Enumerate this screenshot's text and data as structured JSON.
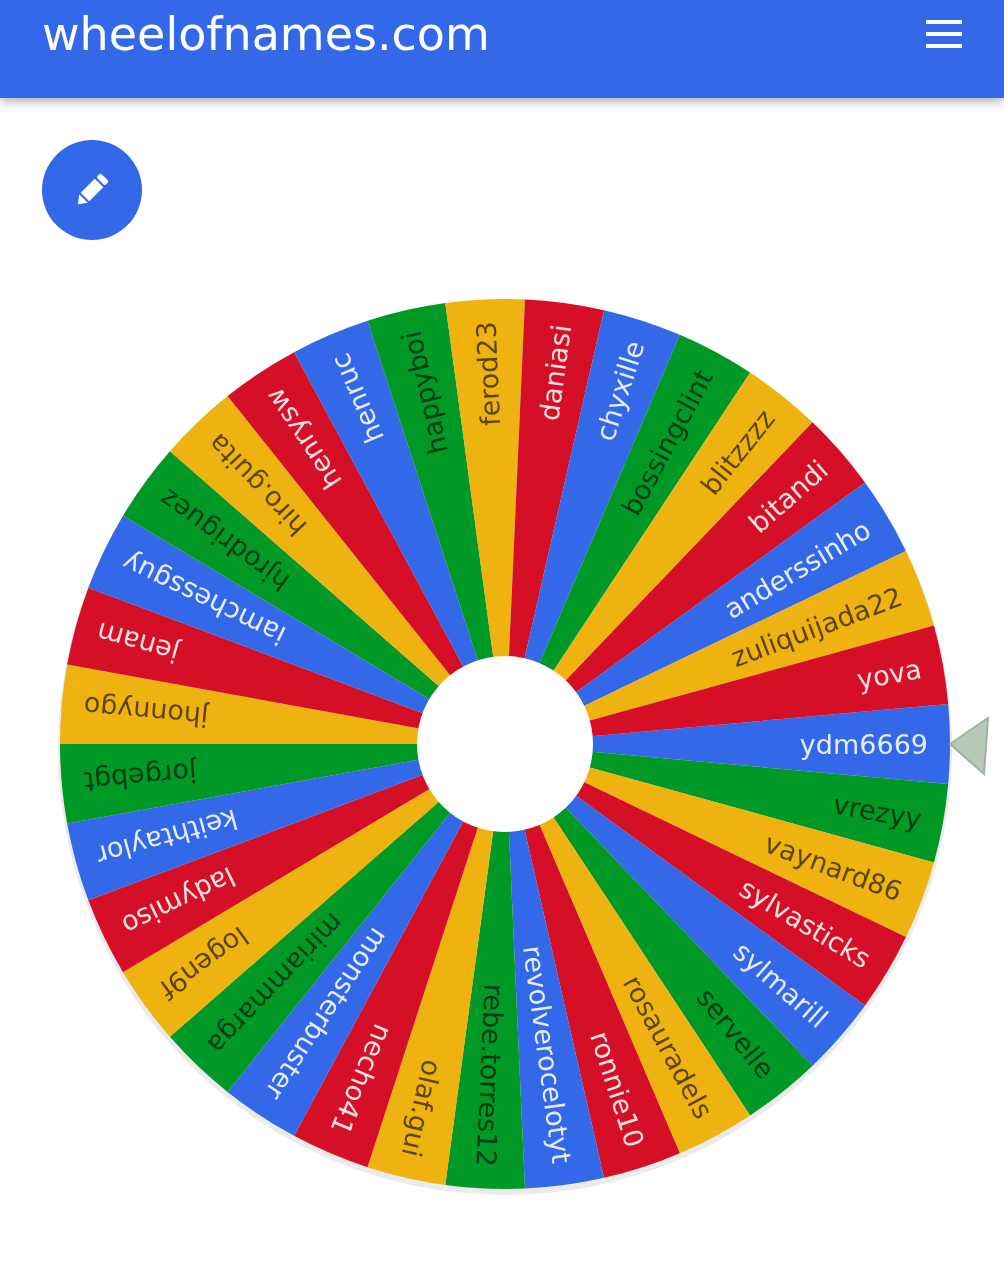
{
  "header": {
    "title": "wheelofnames.com"
  },
  "wheel": {
    "slices": [
      {
        "name": "ydm6669",
        "color": "#3369e8"
      },
      {
        "name": "vrezyy",
        "color": "#009925"
      },
      {
        "name": "vaynard86",
        "color": "#eeb211"
      },
      {
        "name": "sylvasticks",
        "color": "#d50f25"
      },
      {
        "name": "sylmarill",
        "color": "#3369e8"
      },
      {
        "name": "servelle",
        "color": "#009925"
      },
      {
        "name": "rosauradels",
        "color": "#eeb211"
      },
      {
        "name": "ronnie10",
        "color": "#d50f25"
      },
      {
        "name": "revolverocelotyt",
        "color": "#3369e8"
      },
      {
        "name": "rebe.torres12",
        "color": "#009925"
      },
      {
        "name": "olaf.gui",
        "color": "#eeb211"
      },
      {
        "name": "necho41",
        "color": "#d50f25"
      },
      {
        "name": "monsterbuster",
        "color": "#3369e8"
      },
      {
        "name": "miriammarga",
        "color": "#009925"
      },
      {
        "name": "logen9f",
        "color": "#eeb211"
      },
      {
        "name": "ladymiso",
        "color": "#d50f25"
      },
      {
        "name": "keithtaylor",
        "color": "#3369e8"
      },
      {
        "name": "jorgebgt",
        "color": "#009925"
      },
      {
        "name": "jhonnygo",
        "color": "#eeb211"
      },
      {
        "name": "jenam",
        "color": "#d50f25"
      },
      {
        "name": "iamchessguy",
        "color": "#3369e8"
      },
      {
        "name": "hjrodriguez",
        "color": "#009925"
      },
      {
        "name": "hiro.guita",
        "color": "#eeb211"
      },
      {
        "name": "henrysw",
        "color": "#d50f25"
      },
      {
        "name": "henruc",
        "color": "#3369e8"
      },
      {
        "name": "happyboi",
        "color": "#009925"
      },
      {
        "name": "ferod23",
        "color": "#eeb211"
      },
      {
        "name": "daniasi",
        "color": "#d50f25"
      },
      {
        "name": "chyxille",
        "color": "#3369e8"
      },
      {
        "name": "bossingclint",
        "color": "#009925"
      },
      {
        "name": "blitzzzz",
        "color": "#eeb211"
      },
      {
        "name": "bitandi",
        "color": "#d50f25"
      },
      {
        "name": "anderssinho",
        "color": "#3369e8"
      },
      {
        "name": "zuliquijada22",
        "color": "#eeb211"
      },
      {
        "name": "yova",
        "color": "#d50f25"
      }
    ]
  }
}
